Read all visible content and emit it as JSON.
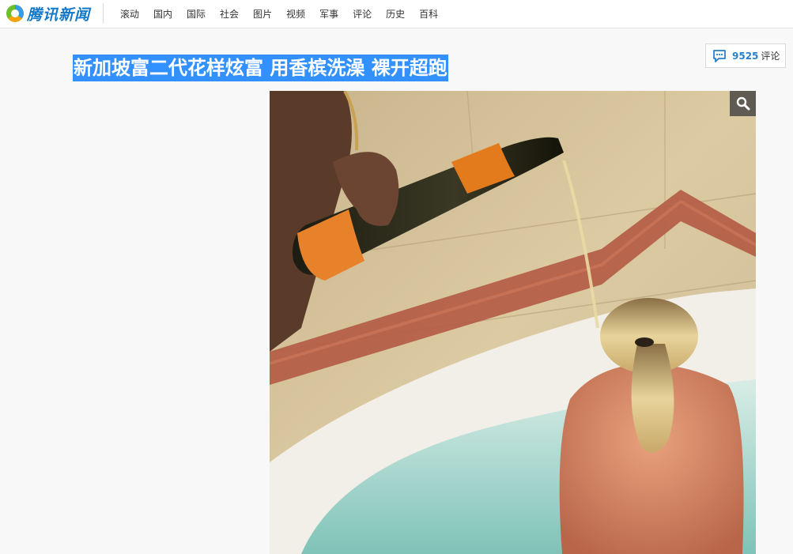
{
  "header": {
    "logo_text": "腾讯新闻",
    "logo_icon": "tencent-news-logo-icon",
    "nav_items": [
      {
        "label": "滚动"
      },
      {
        "label": "国内"
      },
      {
        "label": "国际"
      },
      {
        "label": "社会"
      },
      {
        "label": "图片"
      },
      {
        "label": "视频"
      },
      {
        "label": "军事"
      },
      {
        "label": "评论"
      },
      {
        "label": "历史"
      },
      {
        "label": "百科"
      }
    ]
  },
  "article": {
    "title": "新加坡富二代花样炫富 用香槟洗澡 裸开超跑",
    "title_selected": true,
    "comments": {
      "count": "9525",
      "label": "评论",
      "icon": "comment-bubble-icon"
    },
    "photo": {
      "subject": "champagne-bath-photo",
      "zoom_icon": "magnifier-icon"
    }
  },
  "colors": {
    "selection_highlight": "#3390ff",
    "brand_blue": "#1478c8",
    "comment_count_blue": "#2b7fc8",
    "page_background": "#f8f8f8"
  }
}
